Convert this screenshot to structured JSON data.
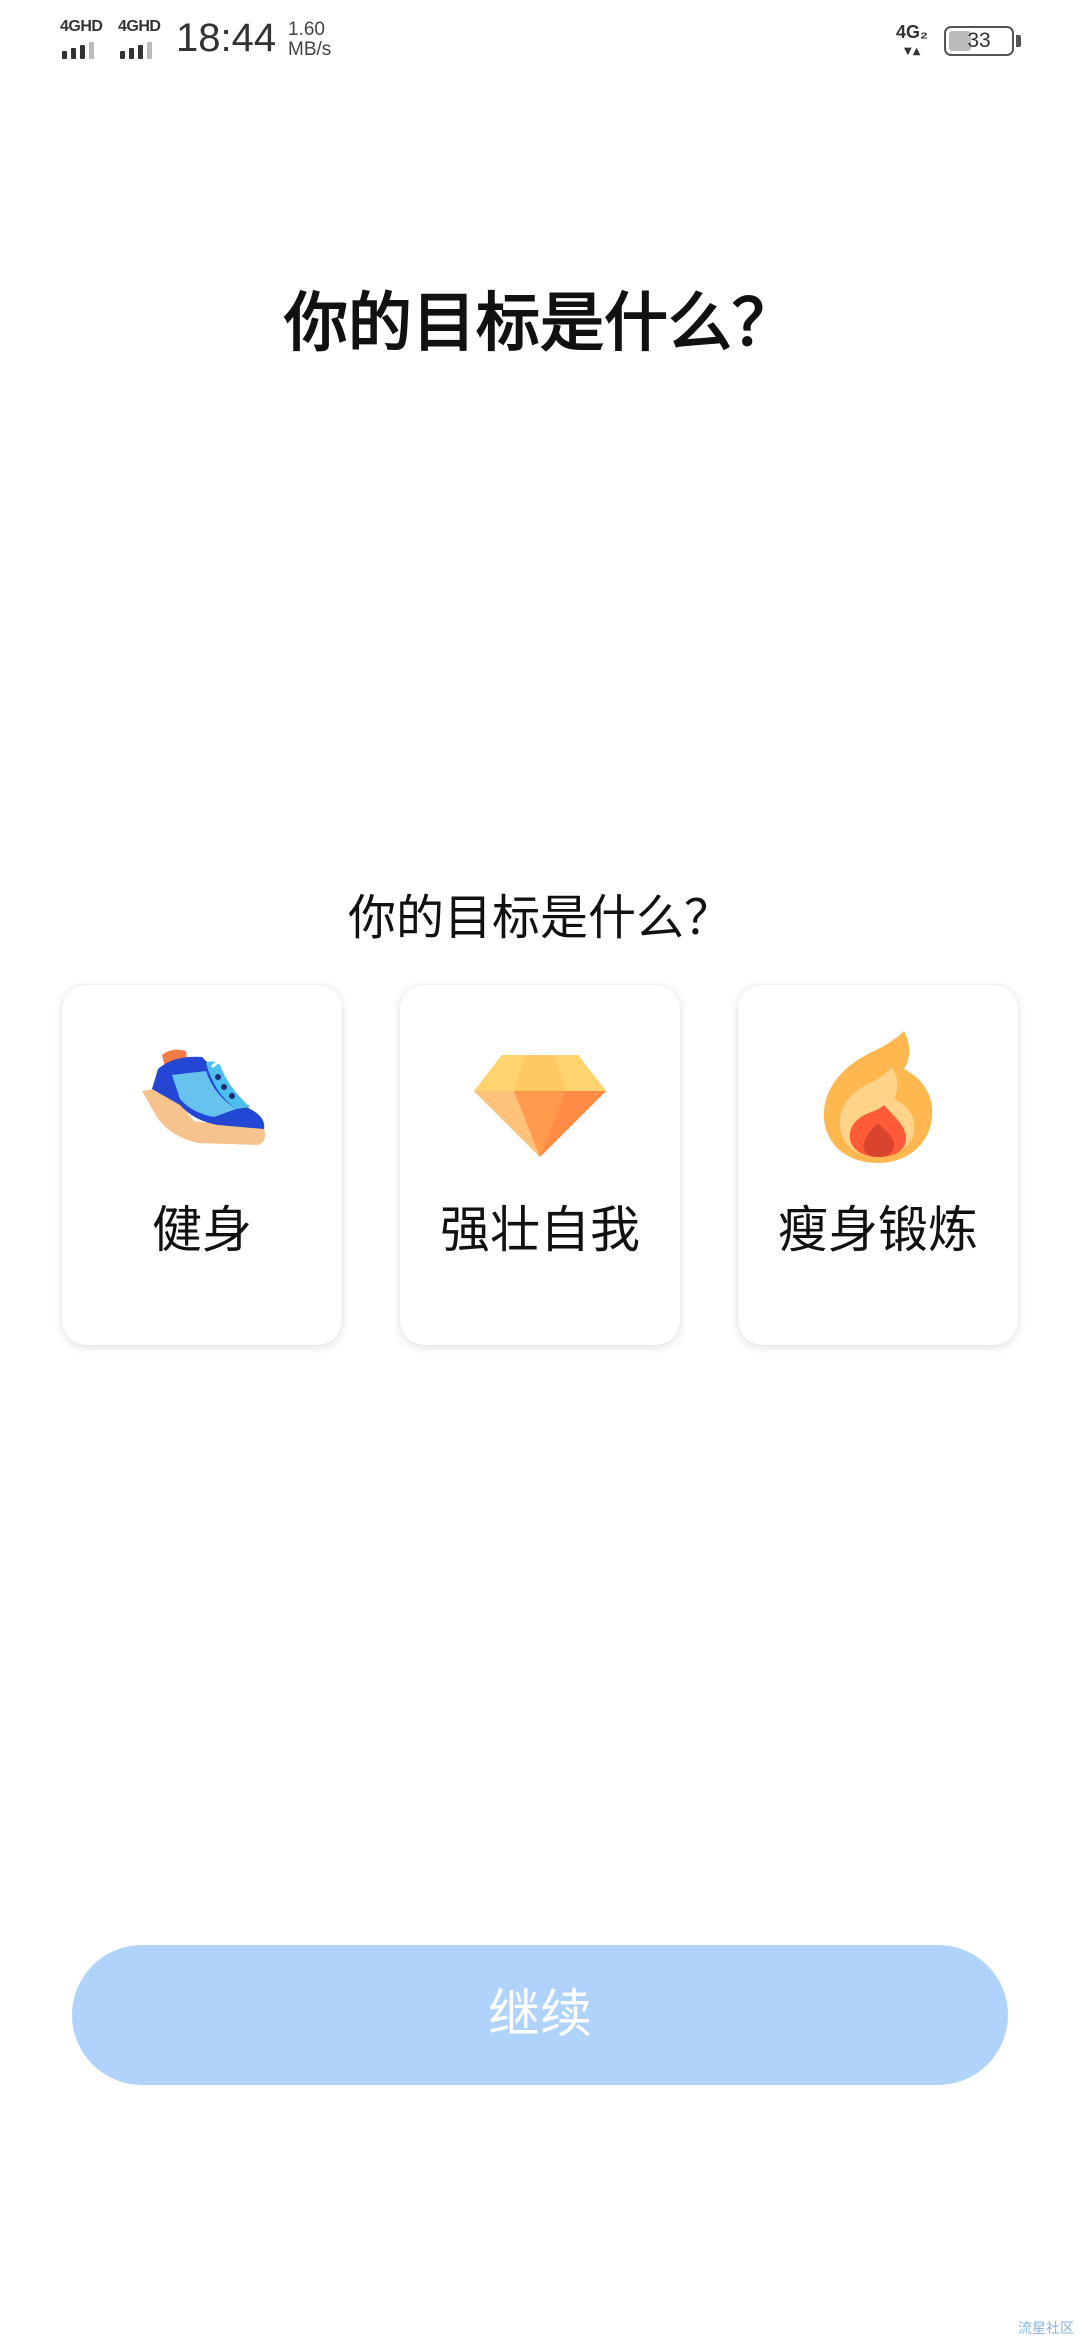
{
  "status_bar": {
    "network_1": "4GHD",
    "network_2": "4GHD",
    "time": "18:44",
    "speed_value": "1.60",
    "speed_unit": "MB/s",
    "network_right": "4G₂",
    "battery_percent": "33",
    "battery_level": 0.33
  },
  "page": {
    "title": "你的目标是什么？",
    "question": "你的目标是什么？"
  },
  "goals": [
    {
      "label": "健身",
      "icon": "sneaker-icon"
    },
    {
      "label": "强壮自我",
      "icon": "diamond-icon"
    },
    {
      "label": "瘦身锻炼",
      "icon": "flame-icon"
    }
  ],
  "continue_button": {
    "label": "继续",
    "enabled": false
  },
  "watermark": "流星社区",
  "colors": {
    "button_disabled": "#b0d3fc",
    "text": "#111111",
    "card_bg": "#ffffff"
  }
}
